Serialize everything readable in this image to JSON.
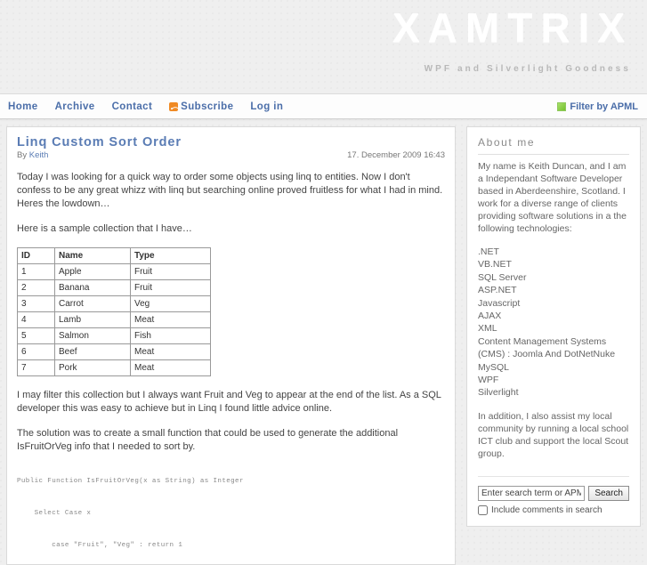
{
  "site": {
    "title": "XAMTRIX",
    "tagline": "WPF and Silverlight Goodness",
    "accent_color": "#4b6ea9",
    "title_color": "#ffffff",
    "background_color": "#efefef"
  },
  "nav": {
    "items": [
      {
        "label": "Home",
        "icon": null
      },
      {
        "label": "Archive",
        "icon": null
      },
      {
        "label": "Contact",
        "icon": null
      },
      {
        "label": "Subscribe",
        "icon": "rss-icon"
      },
      {
        "label": "Log in",
        "icon": null
      }
    ],
    "apml": {
      "label": "Filter by APML",
      "icon": "apml-icon",
      "color": "#74c12e"
    }
  },
  "post": {
    "title": "Linq Custom Sort Order",
    "author_prefix": "By",
    "author": "Keith",
    "date": "17. December 2009 16:43",
    "paragraph1": "Today I was looking for a quick way to order some objects using linq to entities.  Now I don't confess to be any great whizz with linq but searching online proved fruitless for what I had in mind.  Heres the lowdown…",
    "paragraph2": "Here is a sample collection that I have…",
    "paragraph3": "I may filter this collection but I always want Fruit and Veg to appear at the end of the list.  As a SQL developer this was easy to achieve but in Linq I found little advice online.",
    "paragraph4": "The solution was to create a small function that could be used to generate the additional IsFruitOrVeg info that I needed to sort by.",
    "table": {
      "headers": [
        "ID",
        "Name",
        "Type"
      ],
      "rows": [
        [
          "1",
          "Apple",
          "Fruit"
        ],
        [
          "2",
          "Banana",
          "Fruit"
        ],
        [
          "3",
          "Carrot",
          "Veg"
        ],
        [
          "4",
          "Lamb",
          "Meat"
        ],
        [
          "5",
          "Salmon",
          "Fish"
        ],
        [
          "6",
          "Beef",
          "Meat"
        ],
        [
          "7",
          "Pork",
          "Meat"
        ]
      ]
    },
    "code": "Public Function IsFruitOrVeg(x as String) as Integer\n\n    Select Case x\n\n        case \"Fruit\", \"Veg\" : return 1"
  },
  "sidebar": {
    "about": {
      "title": "About me",
      "text": "My name is Keith Duncan, and I am a Independant Software Developer based in Aberdeenshire, Scotland.  I work for a diverse range of clients providing software solutions in a the following technologies:",
      "technologies": [
        ".NET",
        "VB.NET",
        "SQL Server",
        "ASP.NET",
        "Javascript",
        "AJAX",
        "XML",
        "Content Management Systems (CMS) : Joomla And DotNetNuke",
        "MySQL",
        "WPF",
        "Silverlight"
      ],
      "footer": "In addition, I also assist my local community by running a local school ICT club and support the local Scout group."
    },
    "search": {
      "placeholder": "Enter search term or APML url",
      "value": "",
      "button_label": "Search",
      "checkbox_label": "Include comments in search",
      "checkbox_checked": false
    }
  }
}
